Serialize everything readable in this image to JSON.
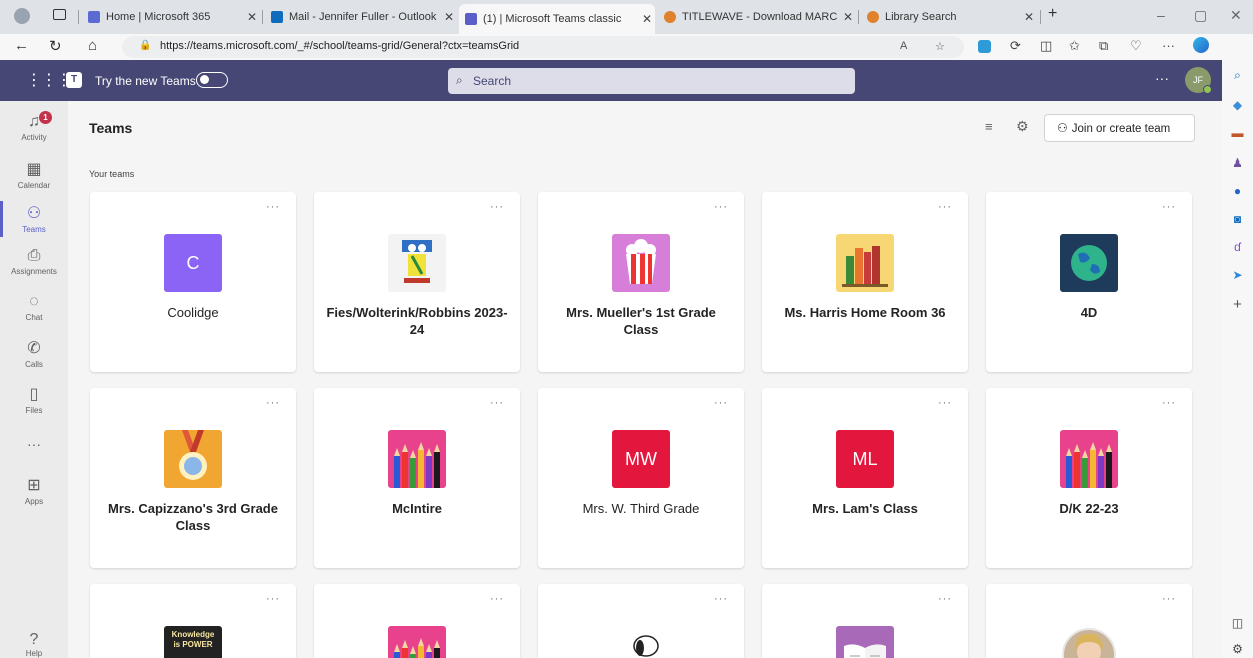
{
  "browser": {
    "tabs": [
      {
        "title": "Home | Microsoft 365",
        "color": "#5b6bd1"
      },
      {
        "title": "Mail - Jennifer Fuller - Outlook",
        "color": "#0f6cbd"
      },
      {
        "title": "(1) | Microsoft Teams classic",
        "color": "#5b5fc7"
      },
      {
        "title": "TITLEWAVE - Download MARC R...",
        "color": "#e0812e"
      },
      {
        "title": "Library Search",
        "color": "#e0812e"
      }
    ],
    "new_tab": "+",
    "url": "https://teams.microsoft.com/_#/school/teams-grid/General?ctx=teamsGrid"
  },
  "teams_bar": {
    "try_new": "Try the new Teams",
    "search_placeholder": "Search",
    "more": "···",
    "avatar_initials": "JF"
  },
  "rail": {
    "items": [
      {
        "label": "Activity",
        "icon": "bell-icon",
        "badge": "1"
      },
      {
        "label": "Calendar",
        "icon": "calendar-icon"
      },
      {
        "label": "Teams",
        "icon": "teams-icon",
        "active": true
      },
      {
        "label": "Assignments",
        "icon": "assignments-icon"
      },
      {
        "label": "Chat",
        "icon": "chat-icon"
      },
      {
        "label": "Calls",
        "icon": "phone-icon"
      },
      {
        "label": "Files",
        "icon": "file-icon"
      }
    ],
    "more": "···",
    "apps_label": "Apps",
    "help_label": "Help"
  },
  "main": {
    "title": "Teams",
    "join_button": "Join or create team",
    "section_label": "Your teams",
    "teams": [
      {
        "name": "Coolidge",
        "tile": "letter",
        "initials": "C",
        "color": "#8b63f5",
        "bold": false
      },
      {
        "name": "Fies/Wolterink/Robbins 2023-24",
        "tile": "cat",
        "bold": true
      },
      {
        "name": "Mrs. Mueller's 1st Grade Class",
        "tile": "popcorn",
        "color": "#d77ed8",
        "bold": true
      },
      {
        "name": "Ms. Harris Home Room 36",
        "tile": "books",
        "color": "#f7d774",
        "bold": true
      },
      {
        "name": "4D",
        "tile": "globe",
        "color": "#1f3b5c",
        "bold": true
      },
      {
        "name": "Mrs. Capizzano's 3rd Grade Class",
        "tile": "medal",
        "color": "#f0a630",
        "bold": true
      },
      {
        "name": "McIntire",
        "tile": "pencils",
        "color": "#e8428c",
        "bold": true
      },
      {
        "name": "Mrs. W. Third Grade",
        "tile": "letter",
        "initials": "MW",
        "color": "#e3173e",
        "bold": false
      },
      {
        "name": "Mrs. Lam's Class",
        "tile": "letter",
        "initials": "ML",
        "color": "#e3173e",
        "bold": true
      },
      {
        "name": "D/K 22-23",
        "tile": "pencils",
        "color": "#e8428c",
        "bold": true
      },
      {
        "name": "",
        "tile": "chalkboard",
        "tile_text": "Knowledge is POWER",
        "color": "#222222",
        "bold": true
      },
      {
        "name": "",
        "tile": "pencils",
        "color": "#e8428c",
        "bold": true
      },
      {
        "name": "",
        "tile": "snoopy",
        "color": "#ffffff",
        "bold": true
      },
      {
        "name": "",
        "tile": "book",
        "color": "#a869b8",
        "bold": true
      },
      {
        "name": "",
        "tile": "photo",
        "color": "#c9b49a",
        "bold": true
      }
    ],
    "card_more": "···"
  }
}
